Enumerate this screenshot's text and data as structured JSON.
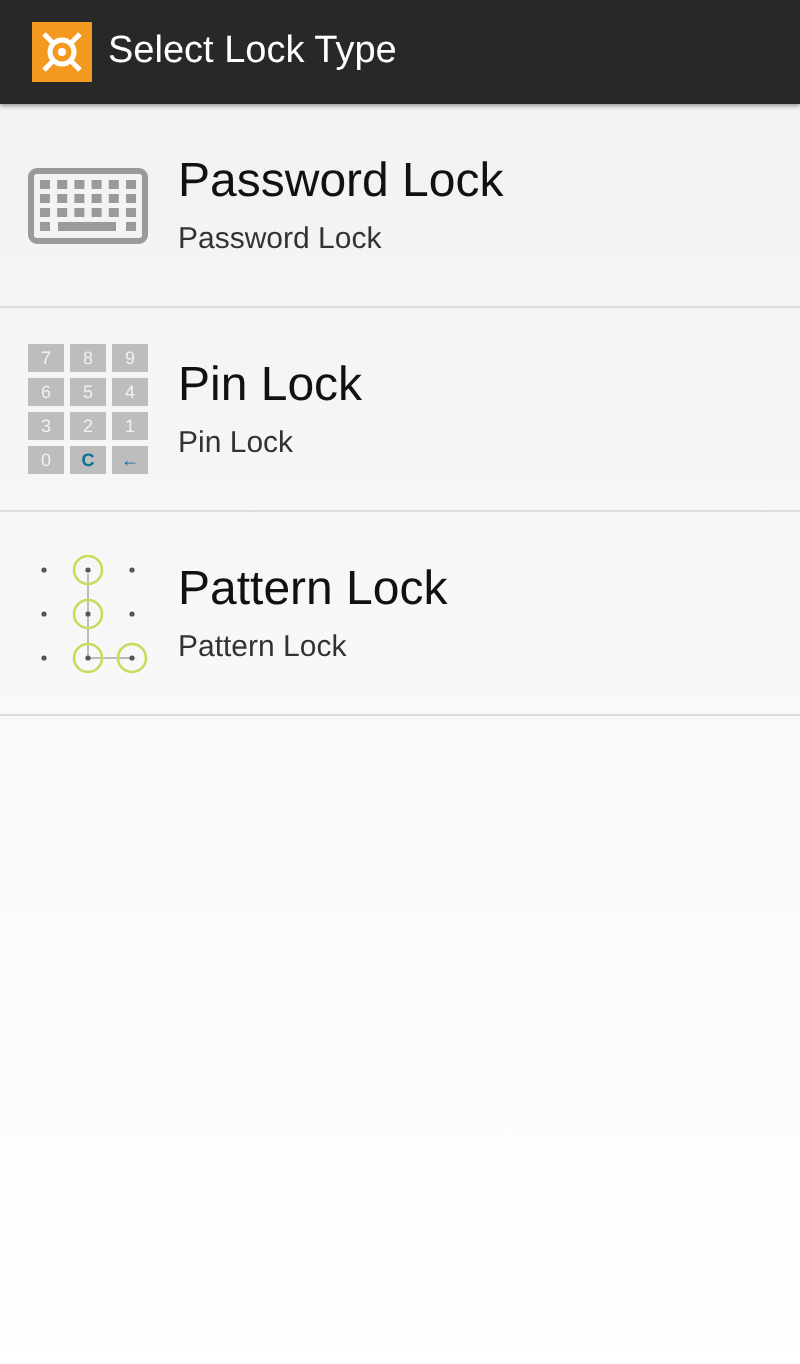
{
  "action_bar": {
    "title": "Select Lock Type"
  },
  "items": [
    {
      "kind": "keyboard",
      "title": "Password Lock",
      "subtitle": "Password Lock"
    },
    {
      "kind": "keypad",
      "title": "Pin Lock",
      "subtitle": "Pin Lock",
      "keys": [
        {
          "label": "7",
          "kind": "digit"
        },
        {
          "label": "8",
          "kind": "digit"
        },
        {
          "label": "9",
          "kind": "digit"
        },
        {
          "label": "6",
          "kind": "digit"
        },
        {
          "label": "5",
          "kind": "digit"
        },
        {
          "label": "4",
          "kind": "digit"
        },
        {
          "label": "3",
          "kind": "digit"
        },
        {
          "label": "2",
          "kind": "digit"
        },
        {
          "label": "1",
          "kind": "digit"
        },
        {
          "label": "0",
          "kind": "digit"
        },
        {
          "label": "C",
          "kind": "action"
        },
        {
          "label": "←",
          "kind": "action"
        }
      ]
    },
    {
      "kind": "pattern",
      "title": "Pattern Lock",
      "subtitle": "Pattern Lock"
    }
  ]
}
